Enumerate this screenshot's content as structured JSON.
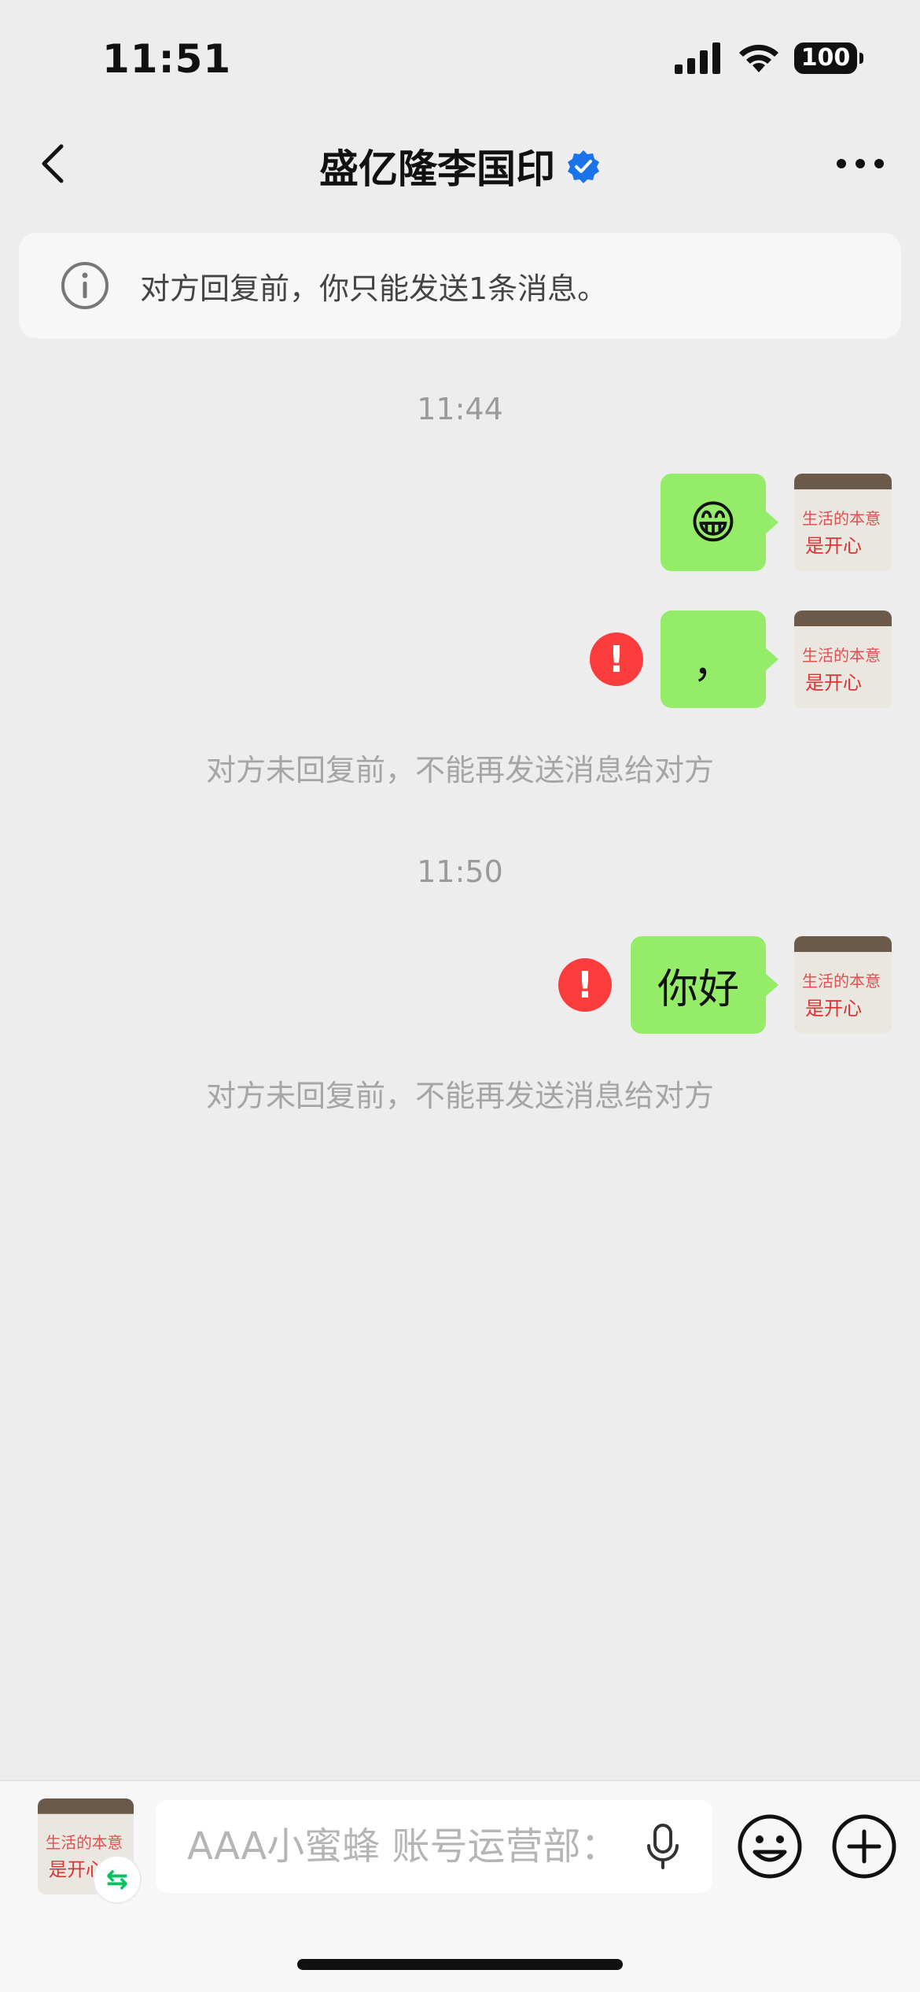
{
  "status_bar": {
    "time": "11:51",
    "battery": "100"
  },
  "nav": {
    "title": "盛亿隆李国印"
  },
  "notice": {
    "text": "对方回复前，你只能发送1条消息。"
  },
  "messages": {
    "time1": "11:44",
    "msg1_emoji": "😁",
    "msg2_text": "，",
    "error_mark": "!",
    "system_notice_1": "对方未回复前，不能再发送消息给对方",
    "time2": "11:50",
    "msg3_text": "你好",
    "system_notice_2": "对方未回复前，不能再发送消息给对方"
  },
  "bottom_bar": {
    "input_placeholder": "AAA小蜜蜂 账号运营部：",
    "switch_badge": "⇆"
  },
  "avatar_text": {
    "line1": "生活的本意",
    "line2": "是开心"
  },
  "colors": {
    "bubble": "#95ec69",
    "error": "#fa3c3c",
    "verified": "#1a73e8",
    "background": "#ededed"
  }
}
